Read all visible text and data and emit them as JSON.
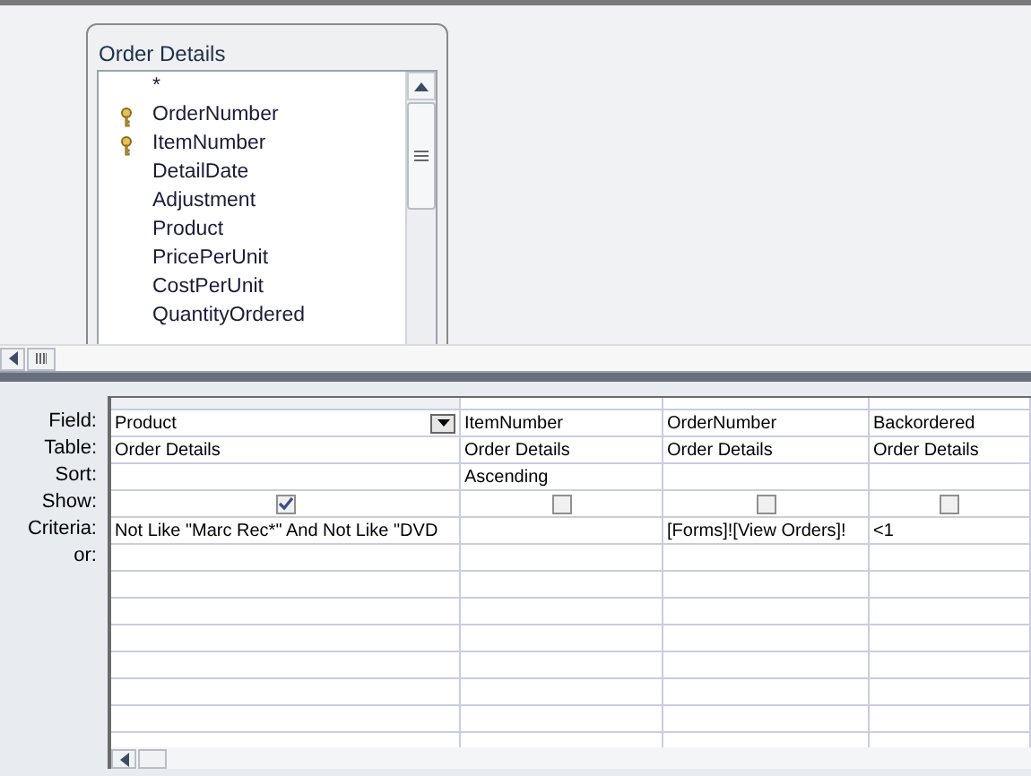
{
  "table_window": {
    "title": "Order Details",
    "fields": [
      {
        "name": "*",
        "primary_key": false
      },
      {
        "name": "OrderNumber",
        "primary_key": true
      },
      {
        "name": "ItemNumber",
        "primary_key": true
      },
      {
        "name": "DetailDate",
        "primary_key": false
      },
      {
        "name": "Adjustment",
        "primary_key": false
      },
      {
        "name": "Product",
        "primary_key": false
      },
      {
        "name": "PricePerUnit",
        "primary_key": false
      },
      {
        "name": "CostPerUnit",
        "primary_key": false
      },
      {
        "name": "QuantityOrdered",
        "primary_key": false
      }
    ]
  },
  "design_grid": {
    "row_labels": [
      "Field:",
      "Table:",
      "Sort:",
      "Show:",
      "Criteria:",
      "or:"
    ],
    "columns": [
      {
        "field": "Product",
        "table": "Order Details",
        "show": true,
        "criteria": "Not Like \"Marc Rec*\" And Not Like \"DVD",
        "selected": true
      },
      {
        "field": "ItemNumber",
        "table": "Order Details",
        "sort": "Ascending",
        "show": false,
        "selected": false
      },
      {
        "field": "OrderNumber",
        "table": "Order Details",
        "show": false,
        "criteria": "[Forms]![View Orders]!",
        "selected": false
      },
      {
        "field": "Backordered",
        "table": "Order Details",
        "show": false,
        "criteria": "<1",
        "selected": false
      }
    ]
  }
}
